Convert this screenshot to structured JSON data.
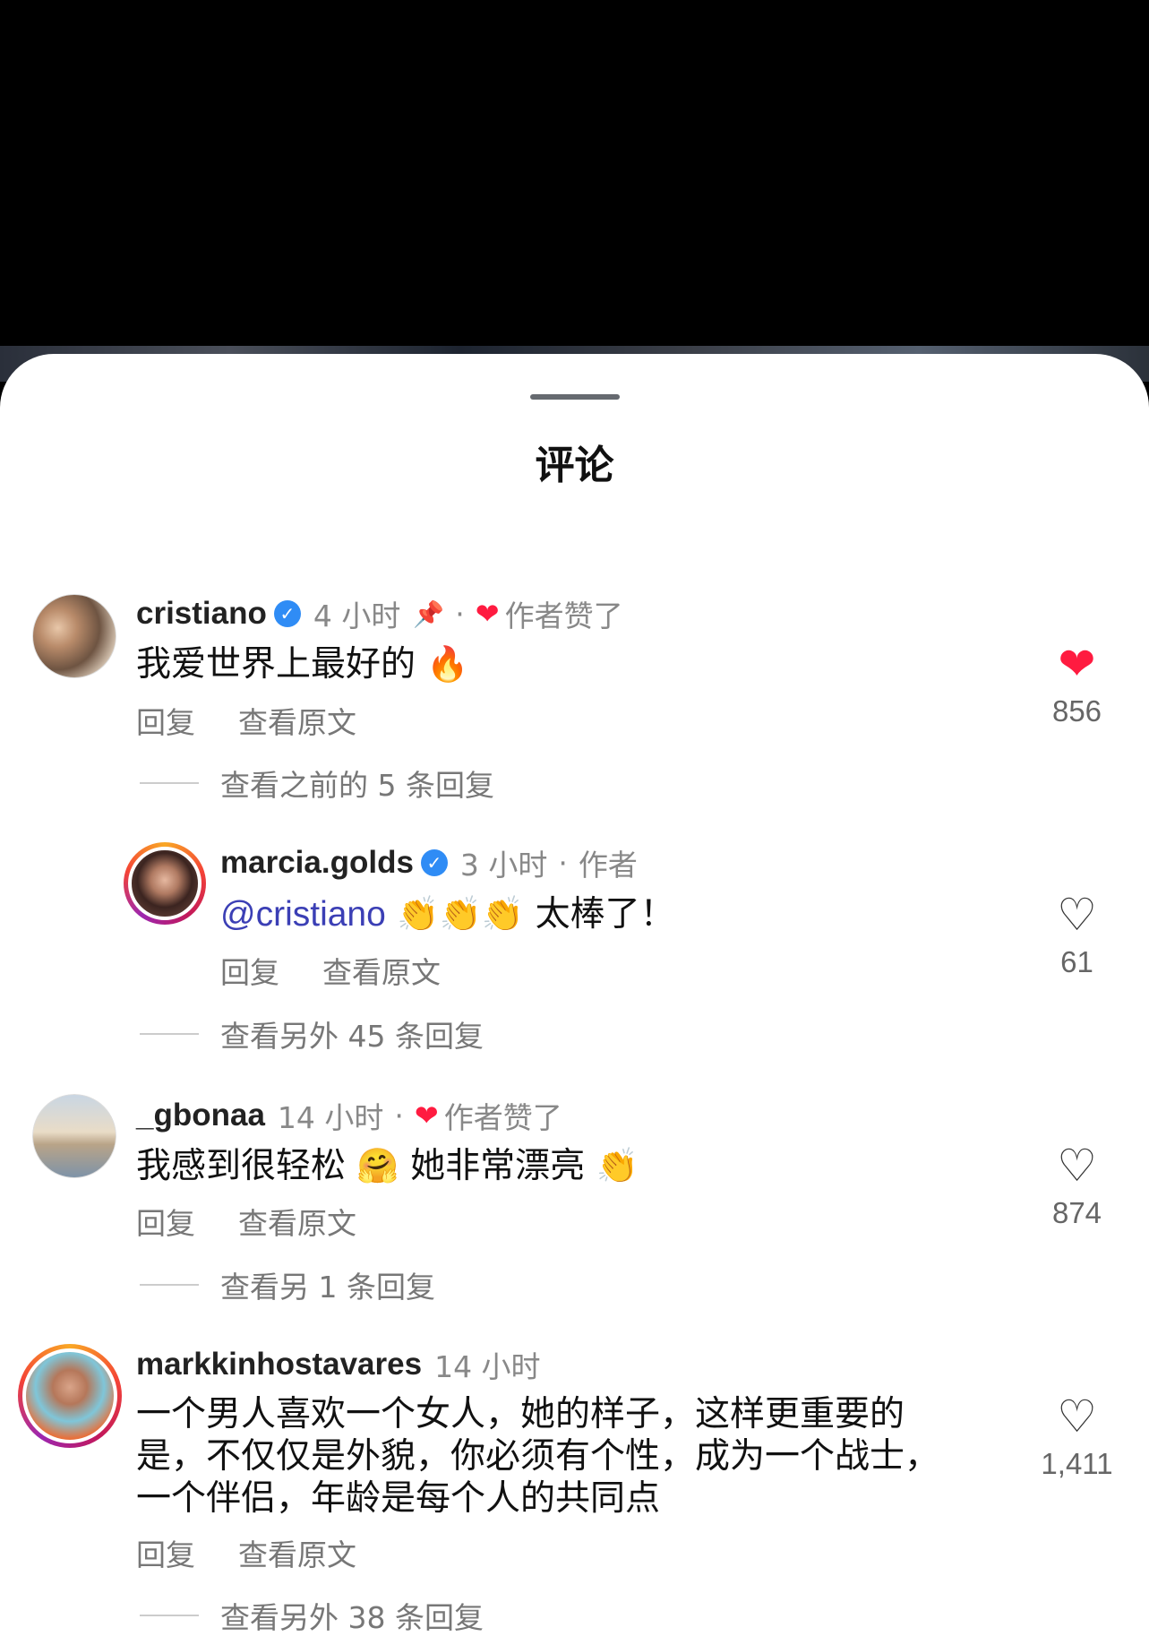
{
  "sheet": {
    "title": "评论"
  },
  "comments": [
    {
      "username": "cristiano",
      "time": "4 小时",
      "author_liked": "作者赞了",
      "text": "我爱世界上最好的",
      "emoji": "🔥",
      "reply": "回复",
      "translate": "查看原文",
      "likes": "856",
      "view_replies": "查看之前的 5 条回复"
    },
    {
      "username": "marcia.golds",
      "time": "3 小时",
      "author_tag": "作者",
      "mention": "@cristiano",
      "emoji": "👏👏👏",
      "text": "太棒了！",
      "reply": "回复",
      "translate": "查看原文",
      "likes": "61",
      "view_replies": "查看另外 45 条回复"
    },
    {
      "username": "_gbonaa",
      "time": "14 小时",
      "author_liked": "作者赞了",
      "text_a": "我感到很轻松",
      "emoji_a": "🤗",
      "text_b": "她非常漂亮",
      "emoji_b": "👏",
      "reply": "回复",
      "translate": "查看原文",
      "likes": "874",
      "view_replies": "查看另 1 条回复"
    },
    {
      "username": "markkinhostavares",
      "time": "14 小时",
      "line1": "一个男人喜欢一个女人，她的样子，这样更重要的",
      "line2": "是，不仅仅是外貌，你必须有个性，成为一个战士，",
      "line3": "一个伴侣，年龄是每个人的共同点",
      "reply": "回复",
      "translate": "查看原文",
      "likes": "1,411",
      "view_replies": "查看另外 38 条回复"
    }
  ],
  "icons": {
    "verified": "✓",
    "heart_filled": "❤",
    "heart_outline": "♡",
    "pin": "📌"
  },
  "colors": {
    "like_red": "#ff1b40",
    "mention_blue": "#3b3fb5",
    "verified_blue": "#2f8cf5"
  }
}
